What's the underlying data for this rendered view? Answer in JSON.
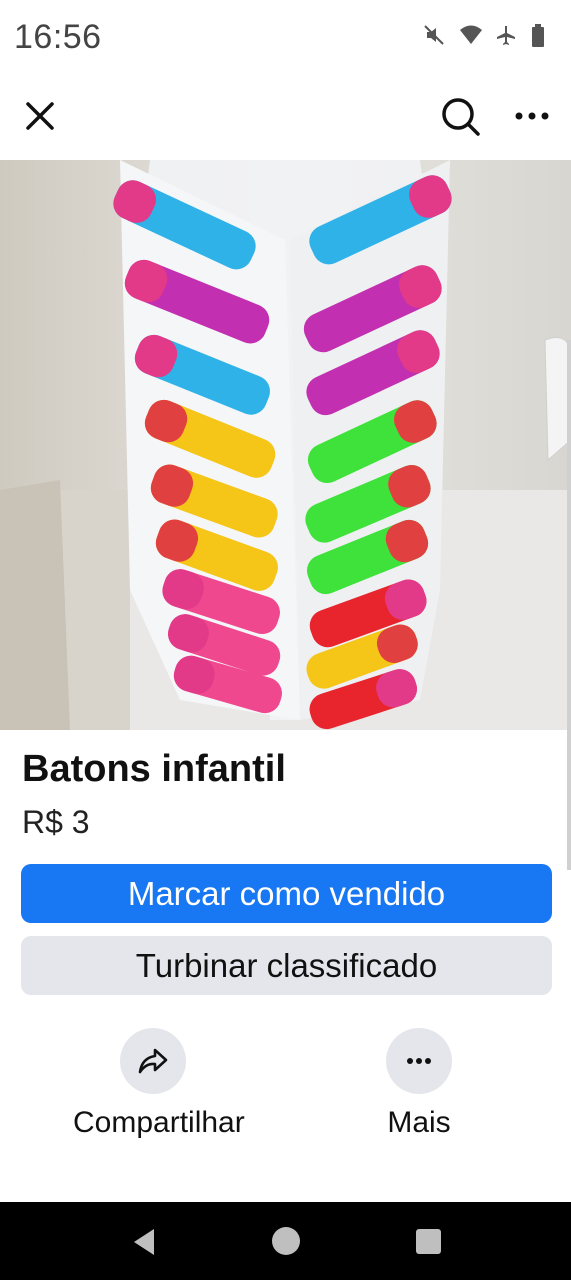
{
  "status_bar": {
    "time": "16:56",
    "icons": [
      "mute-icon",
      "wifi-icon",
      "airplane-mode-icon",
      "battery-icon"
    ]
  },
  "topbar": {
    "icons": [
      "close-icon",
      "search-icon",
      "more-options-icon"
    ]
  },
  "listing": {
    "image_description": "lipstick display",
    "title": "Batons infantil",
    "price": "R$ 3"
  },
  "buttons": {
    "mark_sold": "Marcar como vendido",
    "boost": "Turbinar classificado"
  },
  "actions": {
    "share_label": "Compartilhar",
    "share_icon": "share-icon",
    "more_label": "Mais",
    "more_icon": "more-icon"
  },
  "colors": {
    "accent": "#1877f2",
    "secondary_button": "#e4e6eb",
    "navbar": "#000000"
  },
  "navbar": {
    "icons": [
      "back-icon",
      "home-icon",
      "recent-apps-icon"
    ]
  }
}
